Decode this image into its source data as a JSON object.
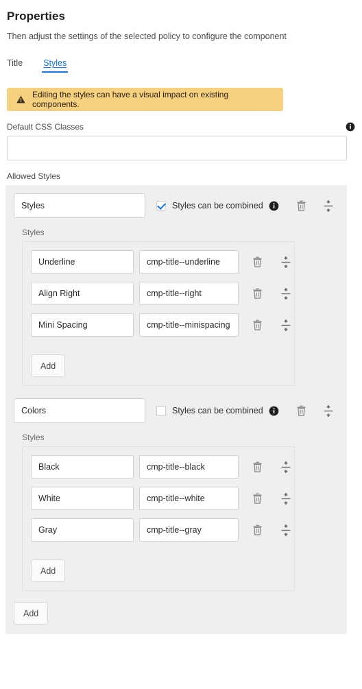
{
  "header": {
    "title": "Properties",
    "subtitle": "Then adjust the settings of the selected policy to configure the component"
  },
  "tabs": [
    {
      "label": "Title",
      "active": false
    },
    {
      "label": "Styles",
      "active": true
    }
  ],
  "warning": {
    "icon": "warning-triangle-icon",
    "text": "Editing the styles can have a visual impact on existing components.",
    "bg_color": "#f5d07f"
  },
  "default_css": {
    "label": "Default CSS Classes",
    "value": "",
    "placeholder": "",
    "info_icon": "info-icon"
  },
  "allowed_styles": {
    "label": "Allowed Styles",
    "add_group_label": "Add",
    "groups": [
      {
        "name": "Styles",
        "combined_label": "Styles can be combined",
        "combined_checked": true,
        "styles_sub_label": "Styles",
        "add_label": "Add",
        "rows": [
          {
            "title": "Underline",
            "css_class": "cmp-title--underline"
          },
          {
            "title": "Align Right",
            "css_class": "cmp-title--right"
          },
          {
            "title": "Mini Spacing",
            "css_class": "cmp-title--minispacing"
          }
        ]
      },
      {
        "name": "Colors",
        "combined_label": "Styles can be combined",
        "combined_checked": false,
        "styles_sub_label": "Styles",
        "add_label": "Add",
        "rows": [
          {
            "title": "Black",
            "css_class": "cmp-title--black"
          },
          {
            "title": "White",
            "css_class": "cmp-title--white"
          },
          {
            "title": "Gray",
            "css_class": "cmp-title--gray"
          }
        ]
      }
    ]
  },
  "icons": {
    "info": "info-icon",
    "delete": "trash-icon",
    "reorder": "drag-reorder-icon"
  },
  "colors": {
    "accent": "#1473e6",
    "panel_bg": "#efefef",
    "warning_bg": "#f5d07f",
    "border": "#d3d3d3"
  }
}
